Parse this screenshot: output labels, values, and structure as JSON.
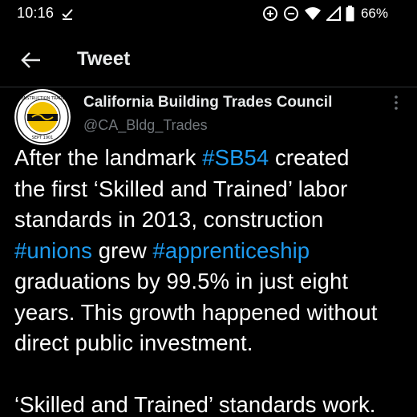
{
  "status_bar": {
    "time": "10:16",
    "battery": "66%"
  },
  "header": {
    "title": "Tweet"
  },
  "tweet": {
    "author_name": "California Building Trades Council",
    "author_handle": "@CA_Bldg_Trades",
    "lines": [
      {
        "segments": [
          {
            "text": "After the landmark "
          },
          {
            "text": "#SB54",
            "hashtag": true
          },
          {
            "text": " created"
          }
        ]
      },
      {
        "segments": [
          {
            "text": "the first ‘Skilled and Trained’ labor"
          }
        ]
      },
      {
        "segments": [
          {
            "text": "standards in 2013, construction"
          }
        ]
      },
      {
        "segments": [
          {
            "text": "#unions",
            "hashtag": true
          },
          {
            "text": " grew "
          },
          {
            "text": "#apprenticeship",
            "hashtag": true
          }
        ]
      },
      {
        "segments": [
          {
            "text": "graduations by 99.5% in just eight"
          }
        ]
      },
      {
        "segments": [
          {
            "text": "years. This growth happened without"
          }
        ]
      },
      {
        "segments": [
          {
            "text": "direct public investment."
          }
        ]
      },
      {
        "segments": []
      },
      {
        "segments": [
          {
            "text": "‘Skilled and Trained’ standards work."
          }
        ]
      }
    ]
  },
  "colors": {
    "background": "#000000",
    "text": "#ffffff",
    "hashtag": "#1d9bf0",
    "secondary": "#71767b"
  },
  "icons": {
    "status_check": "download-done-icon",
    "status_add": "data-saver-icon",
    "status_dnd": "do-not-disturb-icon",
    "status_wifi": "wifi-icon",
    "status_signal": "cell-signal-icon",
    "status_battery": "battery-icon",
    "back": "arrow-left-icon",
    "more": "more-vertical-icon"
  }
}
